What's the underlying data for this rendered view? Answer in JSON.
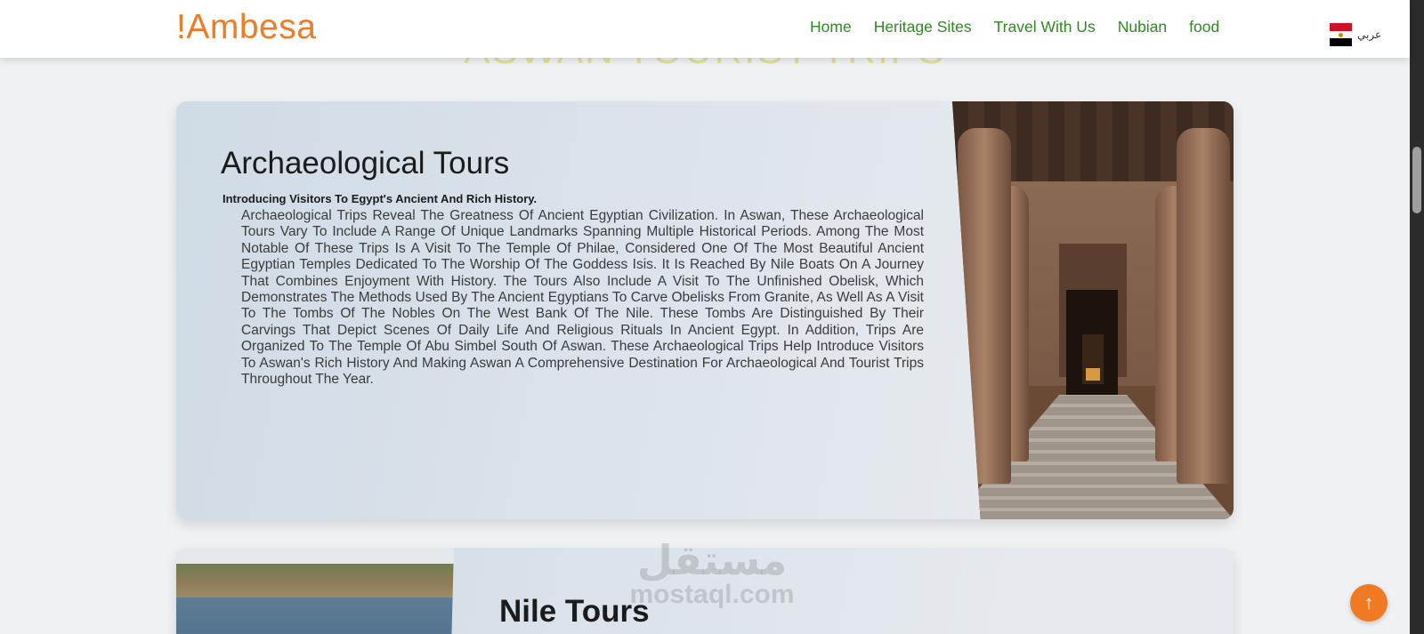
{
  "header": {
    "logo": "!Ambesa",
    "nav": [
      "Home",
      "Heritage Sites",
      "Travel With Us",
      "Nubian",
      "food"
    ],
    "language_label": "عربي"
  },
  "section_title": "Aswan Tourist Trips",
  "card1": {
    "title": "Archaeological Tours",
    "subtitle": "Introducing Visitors To Egypt's Ancient And Rich History.",
    "body": "Archaeological Trips Reveal The Greatness Of Ancient Egyptian Civilization. In Aswan, These Archaeological Tours Vary To Include A Range Of Unique Landmarks Spanning Multiple Historical Periods. Among The Most Notable Of These Trips Is A Visit To The Temple Of Philae, Considered One Of The Most Beautiful Ancient Egyptian Temples Dedicated To The Worship Of The Goddess Isis. It Is Reached By Nile Boats On A Journey That Combines Enjoyment With History. The Tours Also Include A Visit To The Unfinished Obelisk, Which Demonstrates The Methods Used By The Ancient Egyptians To Carve Obelisks From Granite, As Well As A Visit To The Tombs Of The Nobles On The West Bank Of The Nile. These Tombs Are Distinguished By Their Carvings That Depict Scenes Of Daily Life And Religious Rituals In Ancient Egypt. In Addition, Trips Are Organized To The Temple Of Abu Simbel South Of Aswan. These Archaeological Trips Help Introduce Visitors To Aswan's Rich History And Making Aswan A Comprehensive Destination For Archaeological And Tourist Trips Throughout The Year."
  },
  "card2": {
    "title": "Nile Tours"
  },
  "watermark": {
    "arabic": "مستقل",
    "latin": "mostaql.com"
  },
  "back_to_top_icon": "arrow-up-icon",
  "colors": {
    "logo": "#ee7c26",
    "nav": "#2e8b1f",
    "accent_button": "#f07a22"
  }
}
